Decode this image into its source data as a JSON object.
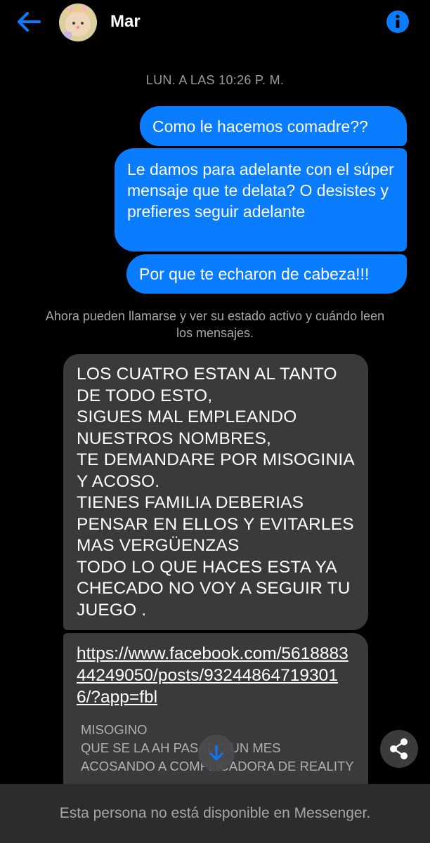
{
  "header": {
    "contact_name": "Mar",
    "back_icon": "arrow-left-icon",
    "info_icon": "info-icon",
    "accent_color": "#0a7cff"
  },
  "thread": {
    "timestamp": "LUN. A LAS 10:26 P. M.",
    "outgoing_messages": [
      "Como le hacemos comadre??",
      "Le damos para adelante con el súper mensaje que te delata? O desistes y prefieres seguir adelante",
      "Por que te echaron de cabeza!!!"
    ],
    "system_notice": "Ahora pueden llamarse y ver su estado activo y cuándo leen los mensajes.",
    "incoming_message": "LOS CUATRO ESTAN AL TANTO DE TODO ESTO,\nSIGUES MAL EMPLEANDO NUESTROS NOMBRES,\nTE DEMANDARE POR MISOGINIA Y ACOSO.\nTIENES FAMILIA DEBERIAS PENSAR EN ELLOS Y EVITARLES MAS VERGÜENZAS\nTODO LO QUE HACES ESTA YA CHECADO NO VOY A SEGUIR TU JUEGO .",
    "link_message": {
      "url": "https://www.facebook.com/561888344249050/posts/932448647193016/?app=fbl",
      "preview_text": "MISOGINO\nQUE SE LA AH PASADO UN MES ACOSANDO A COMPLICADORA DE REALITY"
    }
  },
  "controls": {
    "scroll_down_icon": "arrow-down-icon",
    "share_icon": "share-icon"
  },
  "footer": {
    "unavailable_text": "Esta persona no está disponible en Messenger."
  },
  "colors": {
    "outgoing_bubble": "#0a7cff",
    "incoming_bubble": "#3a3a3c",
    "background": "#000000",
    "footer_background": "#2c2c2e"
  }
}
